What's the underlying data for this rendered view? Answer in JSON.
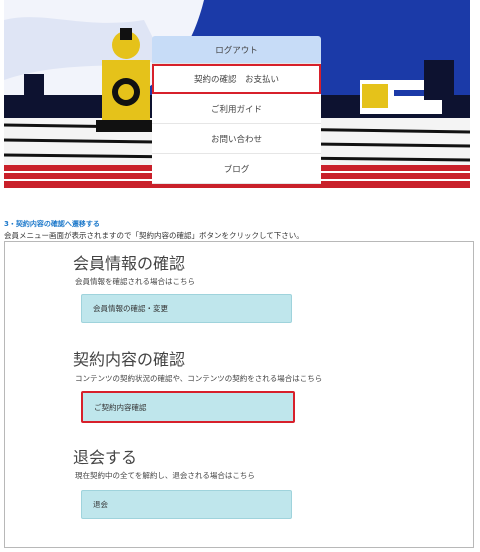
{
  "menu": {
    "logout": "ログアウト",
    "contract_pay": "契約の確認　お支払い",
    "guide": "ご利用ガイド",
    "contact": "お問い合わせ",
    "blog": "ブログ"
  },
  "step": {
    "title": "3・契約内容の確認へ遷移する",
    "desc": "会員メニュー画面が表示されますので「契約内容の確認」ボタンをクリックして下さい。"
  },
  "sections": [
    {
      "heading": "会員情報の確認",
      "desc": "会員情報を確認される場合はこちら",
      "button": "会員情報の確認・変更"
    },
    {
      "heading": "契約内容の確認",
      "desc": "コンテンツの契約状況の確認や、コンテンツの契約をされる場合はこちら",
      "button": "ご契約内容確認"
    },
    {
      "heading": "退会する",
      "desc": "現在契約中の全てを解約し、退会される場合はこちら",
      "button": "退会"
    }
  ],
  "colors": {
    "highlight": "#d7202b",
    "menu_primary": "#c7dcf7",
    "button_bg": "#bfe6ec",
    "step_title": "#1f7acb"
  }
}
